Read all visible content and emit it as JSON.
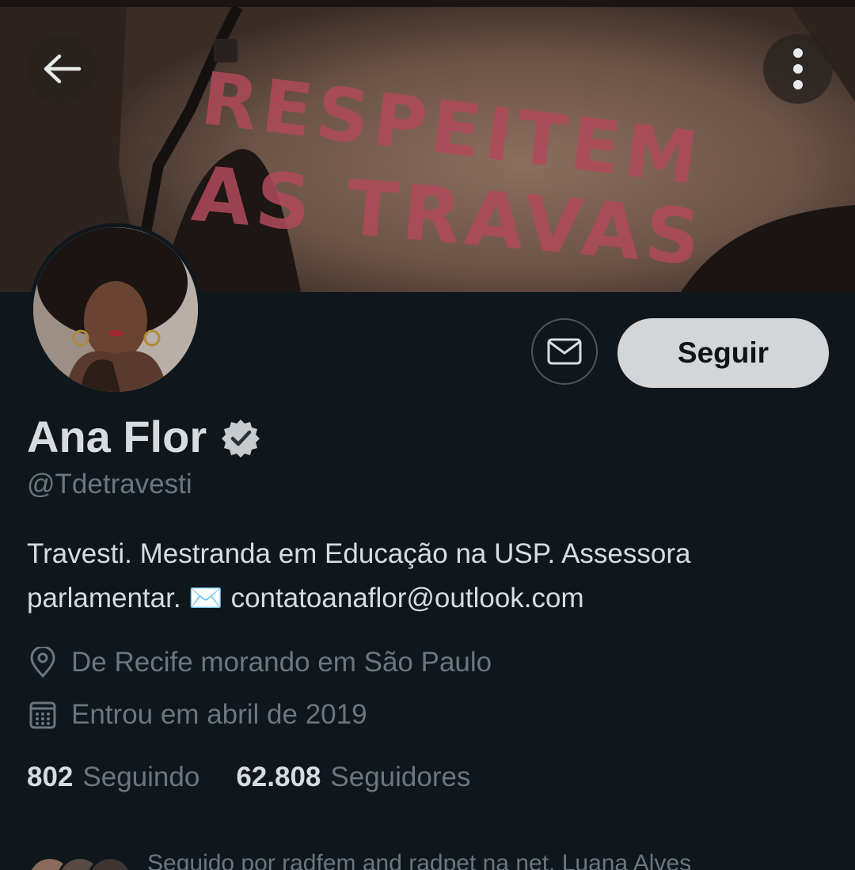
{
  "header": {
    "back_icon": "arrow-left-icon",
    "more_icon": "more-vertical-icon",
    "banner_text_line1": "RESPEITEM",
    "banner_text_line2": "AS TRAVAS"
  },
  "profile": {
    "name": "Ana Flor",
    "verified_icon": "verified-badge-icon",
    "handle": "@Tdetravesti",
    "bio_line1": "Travesti. Mestranda em Educação na USP. Assessora",
    "bio_line2": "parlamentar. ✉️ contatoanaflor@outlook.com",
    "location": "De Recife morando em São Paulo",
    "joined": "Entrou em abril de 2019"
  },
  "actions": {
    "message_icon": "envelope-icon",
    "follow_label": "Seguir"
  },
  "stats": {
    "following_count": "802",
    "following_label": "Seguindo",
    "followers_count": "62.808",
    "followers_label": "Seguidores"
  },
  "followed_by": {
    "text": "Seguido por radfem and radpet na net, Luana Alves"
  },
  "colors": {
    "background": "#0f171d",
    "follow_button_bg": "#d3d5d7",
    "secondary_text": "#6b767e",
    "primary_text": "#d9dcdf"
  }
}
